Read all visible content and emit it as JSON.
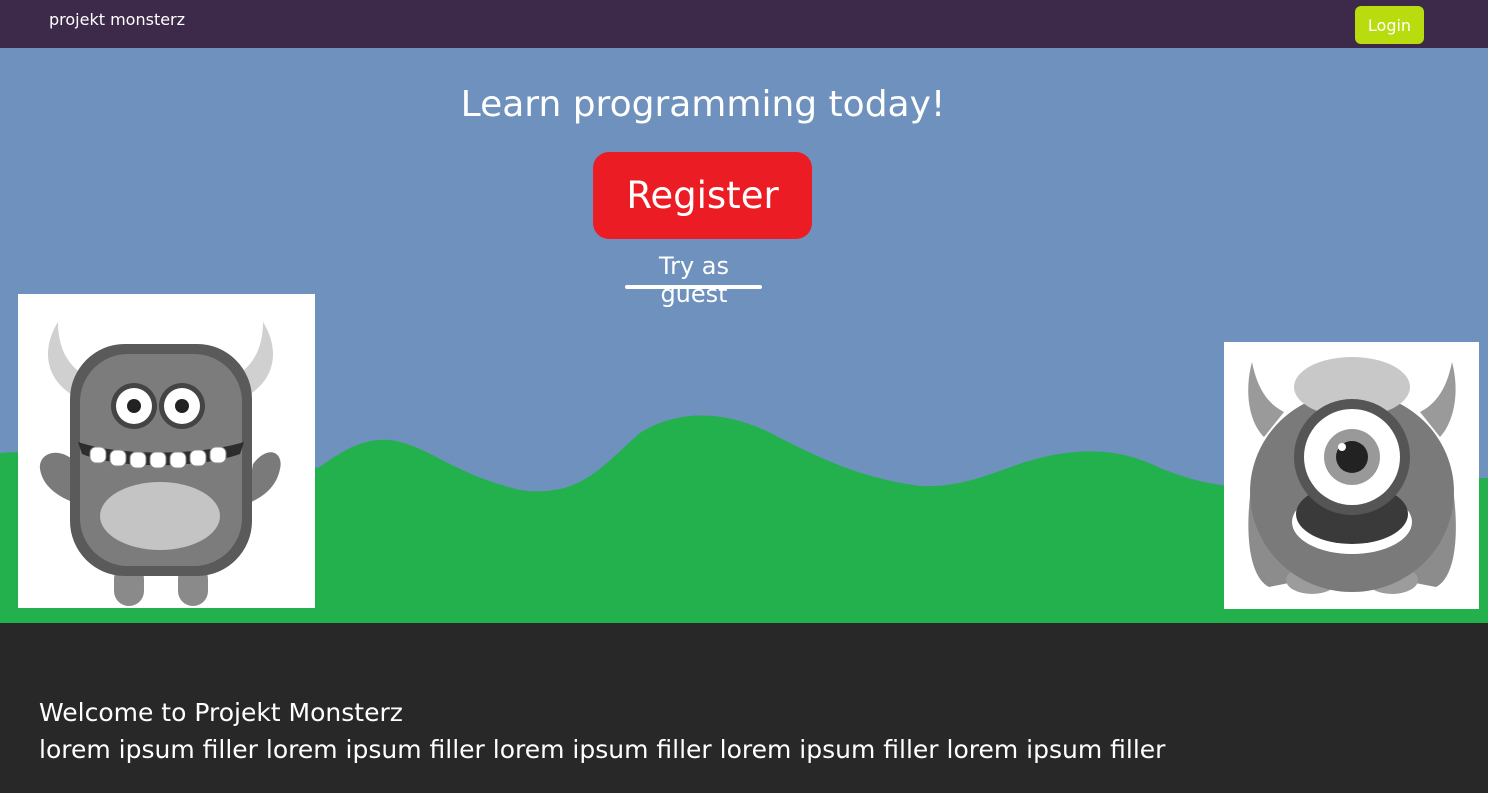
{
  "nav": {
    "brand": "projekt monsterz",
    "login_label": "Login"
  },
  "hero": {
    "headline": "Learn programming today!",
    "register_label": "Register",
    "guest_label": "Try as guest"
  },
  "footer": {
    "title": "Welcome to Projekt Monsterz",
    "text": "lorem ipsum filler lorem ipsum filler lorem ipsum filler lorem ipsum filler lorem ipsum filler"
  },
  "colors": {
    "navbar": "#3d2a4a",
    "login_button": "#b9dc0f",
    "sky": "#6e91bd",
    "grass": "#22b14c",
    "register_button": "#ec1c24",
    "footer": "#282828"
  },
  "images": {
    "left": "horned-grey-monster",
    "right": "one-eyed-grey-monster"
  }
}
